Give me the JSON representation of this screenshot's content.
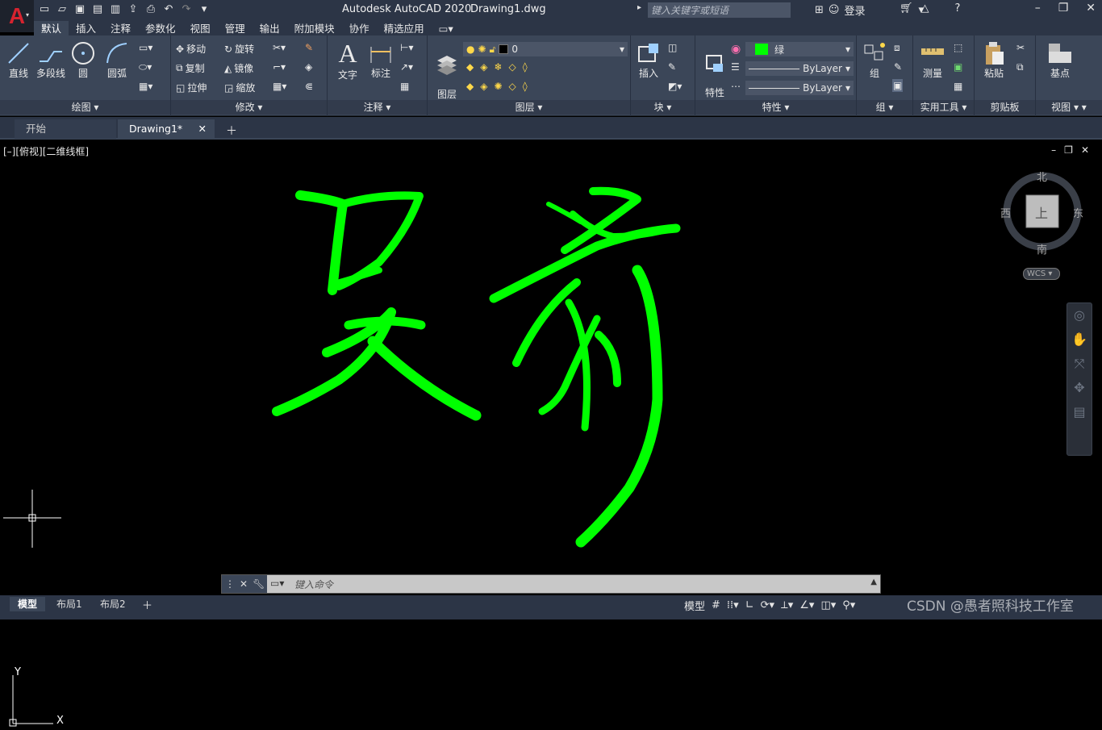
{
  "titlebar": {
    "app": "Autodesk AutoCAD 2020",
    "document": "Drawing1.dwg",
    "search_placeholder": "键入关键字或短语",
    "login": "登录"
  },
  "ribbon_tabs": [
    "默认",
    "插入",
    "注释",
    "参数化",
    "视图",
    "管理",
    "输出",
    "附加模块",
    "协作",
    "精选应用"
  ],
  "panels": {
    "draw": {
      "title": "绘图",
      "tools": [
        "直线",
        "多段线",
        "圆",
        "圆弧"
      ]
    },
    "modify": {
      "title": "修改",
      "tools": [
        "移动",
        "旋转",
        "复制",
        "镜像",
        "拉伸",
        "缩放"
      ]
    },
    "annotation": {
      "title": "注释",
      "tools": [
        "文字",
        "标注"
      ]
    },
    "layers": {
      "title": "图层",
      "layer_props": "图层\n特性",
      "current_layer": "0"
    },
    "block": {
      "title": "块",
      "tools": [
        "插入"
      ]
    },
    "properties": {
      "title": "特性",
      "match": "特性\n匹配",
      "color": "绿",
      "linetype": "ByLayer",
      "lineweight": "ByLayer"
    },
    "groups": {
      "title": "组",
      "tools": [
        "组"
      ]
    },
    "utilities": {
      "title": "实用工具",
      "tools": [
        "测量"
      ]
    },
    "clipboard": {
      "title": "剪贴板",
      "tools": [
        "粘贴"
      ]
    },
    "view": {
      "title": "视图",
      "tools": [
        "基点"
      ]
    }
  },
  "doc_tabs": {
    "start": "开始",
    "active": "Drawing1*"
  },
  "viewport": {
    "label": "[–][俯视][二维线框]",
    "viewcube": {
      "north": "北",
      "south": "南",
      "east": "东",
      "west": "西",
      "top": "上",
      "wcs": "WCS"
    },
    "ucs": {
      "x": "X",
      "y": "Y"
    },
    "drawing_color": "#00ff00"
  },
  "command": {
    "placeholder": "键入命令"
  },
  "status": {
    "layouts": [
      "模型",
      "布局1",
      "布局2"
    ],
    "model": "模型"
  },
  "watermark": "CSDN @愚者照科技工作室"
}
